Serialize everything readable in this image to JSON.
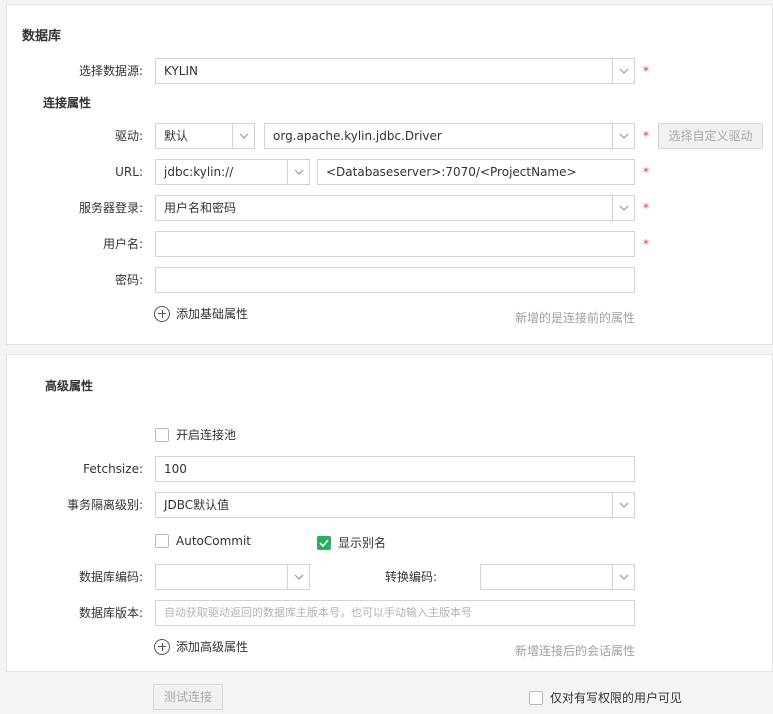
{
  "database_section": {
    "title": "数据库",
    "datasource": {
      "label": "选择数据源:",
      "value": "KYLIN"
    },
    "connection_title": "连接属性",
    "driver": {
      "label": "驱动:",
      "type_value": "默认",
      "class_value": "org.apache.kylin.jdbc.Driver",
      "custom_button": "选择自定义驱动"
    },
    "url": {
      "label": "URL:",
      "prefix_value": "jdbc:kylin://",
      "value": "<Databaseserver>:7070/<ProjectName>"
    },
    "server_login": {
      "label": "服务器登录:",
      "value": "用户名和密码"
    },
    "username": {
      "label": "用户名:",
      "value": ""
    },
    "password": {
      "label": "密码:",
      "value": ""
    },
    "add_basic": "添加基础属性",
    "basic_hint": "新增的是连接前的属性",
    "required_mark": "*"
  },
  "advanced_section": {
    "title": "高级属性",
    "pool": {
      "label": "开启连接池",
      "checked": false
    },
    "fetchsize": {
      "label": "Fetchsize:",
      "value": "100"
    },
    "isolation": {
      "label": "事务隔离级别:",
      "value": "JDBC默认值"
    },
    "autocommit": {
      "label": "AutoCommit",
      "checked": false
    },
    "show_alias": {
      "label": "显示别名",
      "checked": true
    },
    "db_encoding": {
      "label": "数据库编码:",
      "value": ""
    },
    "convert_encoding": {
      "label": "转换编码:",
      "value": ""
    },
    "db_version": {
      "label": "数据库版本:",
      "placeholder": "自动获取驱动返回的数据库主版本号，也可以手动输入主版本号"
    },
    "add_advanced": "添加高级属性",
    "advanced_hint": "新增连接后的会话属性"
  },
  "footer": {
    "test_button": "测试连接",
    "writers_only": {
      "label": "仅对有写权限的用户可见",
      "checked": false
    }
  },
  "colors": {
    "required": "#e4393c",
    "checkbox_on": "#27ae60",
    "hint": "#a0a0a0"
  },
  "icons": {
    "caret": "chevron-down-icon",
    "add": "plus-circle-icon",
    "check": "check-icon"
  }
}
